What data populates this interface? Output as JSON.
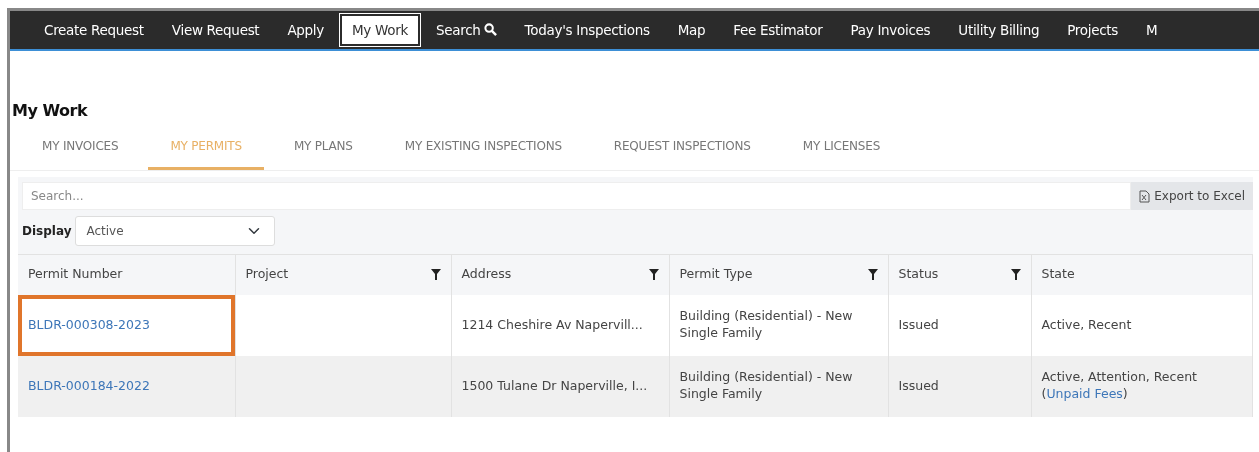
{
  "nav": [
    {
      "label": "Create Request",
      "selected": false
    },
    {
      "label": "View Request",
      "selected": false
    },
    {
      "label": "Apply",
      "selected": false
    },
    {
      "label": "My Work",
      "selected": true
    },
    {
      "label": "Search",
      "selected": false,
      "kind": "search"
    },
    {
      "label": "Today's Inspections",
      "selected": false
    },
    {
      "label": "Map",
      "selected": false
    },
    {
      "label": "Fee Estimator",
      "selected": false
    },
    {
      "label": "Pay Invoices",
      "selected": false
    },
    {
      "label": "Utility Billing",
      "selected": false
    },
    {
      "label": "Projects",
      "selected": false
    },
    {
      "label": "M",
      "selected": false
    }
  ],
  "page_title": "My Work",
  "tabs": [
    {
      "label": "MY INVOICES",
      "selected": false
    },
    {
      "label": "MY PERMITS",
      "selected": true
    },
    {
      "label": "MY PLANS",
      "selected": false
    },
    {
      "label": "MY EXISTING INSPECTIONS",
      "selected": false
    },
    {
      "label": "REQUEST INSPECTIONS",
      "selected": false
    },
    {
      "label": "MY LICENSES",
      "selected": false
    }
  ],
  "search": {
    "placeholder": "Search..."
  },
  "export_button": "Export to Excel",
  "display": {
    "label": "Display",
    "value": "Active"
  },
  "table": {
    "columns": [
      {
        "label": "Permit Number",
        "filter": false
      },
      {
        "label": "Project",
        "filter": true
      },
      {
        "label": "Address",
        "filter": true
      },
      {
        "label": "Permit Type",
        "filter": true
      },
      {
        "label": "Status",
        "filter": true
      },
      {
        "label": "State",
        "filter": false
      }
    ],
    "rows": [
      {
        "permit": "BLDR-000308-2023",
        "highlighted": true,
        "project": "",
        "address": "1214 Cheshire Av Napervill...",
        "permit_type": "Building (Residential) - New Single Family",
        "status": "Issued",
        "state": "Active, Recent"
      },
      {
        "permit": "BLDR-000184-2022",
        "highlighted": false,
        "project": "",
        "address": "1500 Tulane Dr Naperville, I...",
        "permit_type": "Building (Residential) - New Single Family",
        "status": "Issued",
        "state": "Active, Attention, Recent",
        "note": {
          "open": "(",
          "link": "Unpaid Fees",
          "close": ")"
        }
      }
    ]
  }
}
